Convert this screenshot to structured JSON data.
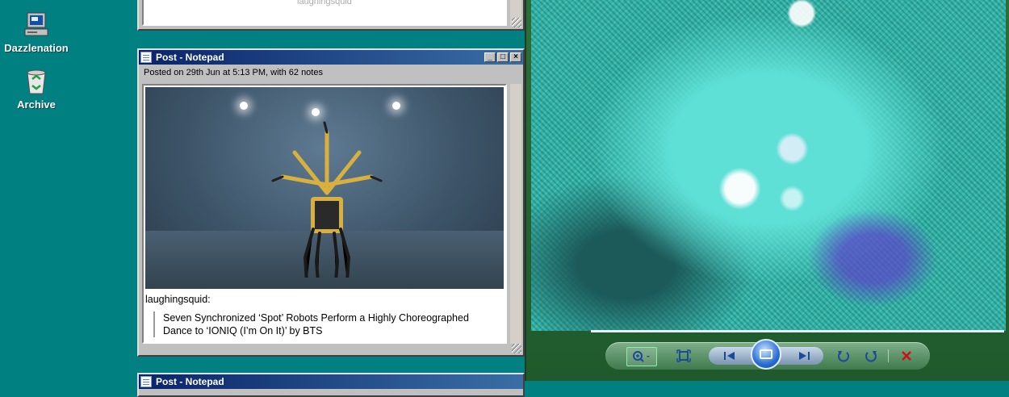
{
  "desktop": {
    "icons": [
      {
        "label": "Dazzlenation",
        "icon": "computer-icon"
      },
      {
        "label": "Archive",
        "icon": "recycle-bin-icon"
      }
    ]
  },
  "top_window": {
    "partial_text": "laughingsquid"
  },
  "post_window": {
    "title": "Post - Notepad",
    "meta": "Posted on 29th Jun at 5:13 PM, with 62 notes",
    "source": "laughingsquid:",
    "quote": "Seven Synchronized ‘Spot’ Robots Perform a Highly Choreographed Dance to ‘IONIQ (I’m On It)’ by BTS",
    "buttons": {
      "minimize": "_",
      "maximize": "□",
      "close": "×"
    }
  },
  "bottom_window": {
    "title": "Post - Notepad"
  },
  "viewer": {
    "controls": [
      "zoom",
      "actual-size",
      "previous",
      "slideshow",
      "next",
      "rotate-counterclockwise",
      "rotate-clockwise",
      "delete"
    ],
    "accent": "#1b4a9a",
    "delete_color": "#d01010"
  }
}
